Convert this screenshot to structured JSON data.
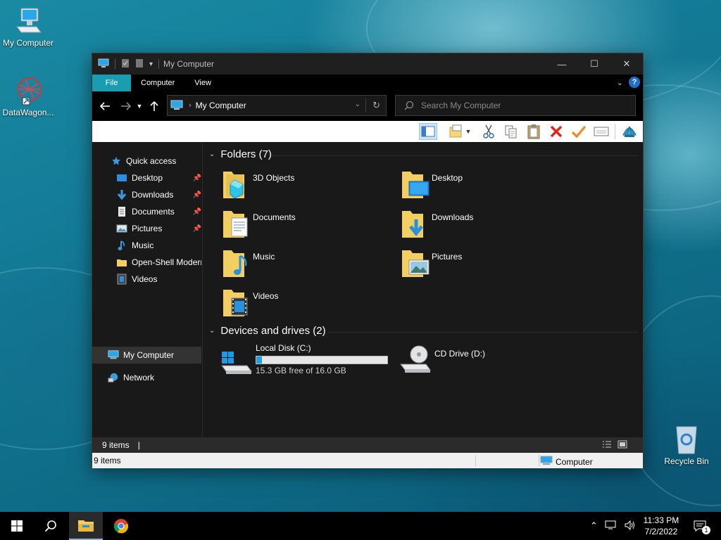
{
  "desktop": {
    "icons": [
      {
        "label": "My Computer"
      },
      {
        "label": "DataWagon..."
      },
      {
        "label": "Recycle Bin"
      }
    ]
  },
  "window": {
    "title": "My Computer",
    "controls": {
      "minimize": "—",
      "maximize": "☐",
      "close": "✕"
    },
    "ribbon": {
      "tabs": [
        {
          "label": "File"
        },
        {
          "label": "Computer"
        },
        {
          "label": "View"
        }
      ],
      "help": "?"
    },
    "address": {
      "location": "My Computer"
    },
    "search": {
      "placeholder": "Search My Computer"
    },
    "nav": {
      "quick_access": "Quick access",
      "items": [
        {
          "label": "Desktop",
          "pinned": true
        },
        {
          "label": "Downloads",
          "pinned": true
        },
        {
          "label": "Documents",
          "pinned": true
        },
        {
          "label": "Pictures",
          "pinned": true
        },
        {
          "label": "Music",
          "pinned": false
        },
        {
          "label": "Open-Shell Modern",
          "pinned": false
        },
        {
          "label": "Videos",
          "pinned": false
        }
      ],
      "my_computer": "My Computer",
      "network": "Network"
    },
    "content": {
      "folders_heading": "Folders (7)",
      "folders": [
        {
          "label": "3D Objects",
          "icon": "3d-objects-icon"
        },
        {
          "label": "Desktop",
          "icon": "desktop-icon"
        },
        {
          "label": "Documents",
          "icon": "documents-icon"
        },
        {
          "label": "Downloads",
          "icon": "downloads-icon"
        },
        {
          "label": "Music",
          "icon": "music-icon"
        },
        {
          "label": "Pictures",
          "icon": "pictures-icon"
        },
        {
          "label": "Videos",
          "icon": "videos-icon"
        }
      ],
      "drives_heading": "Devices and drives (2)",
      "drives": [
        {
          "label": "Local Disk (C:)",
          "free_text": "15.3 GB free of 16.0 GB",
          "used_fraction": 0.044
        },
        {
          "label": "CD Drive (D:)"
        }
      ]
    },
    "status": {
      "items": "9 items",
      "cursor": "|"
    },
    "status2": {
      "items": "9 items",
      "zone": "Computer"
    }
  },
  "taskbar": {
    "time": "11:33 PM",
    "date": "7/2/2022",
    "notifications": "1"
  },
  "colors": {
    "accent": "#1a9db0",
    "selection": "#333333",
    "bar_fill": "#26a0da"
  }
}
